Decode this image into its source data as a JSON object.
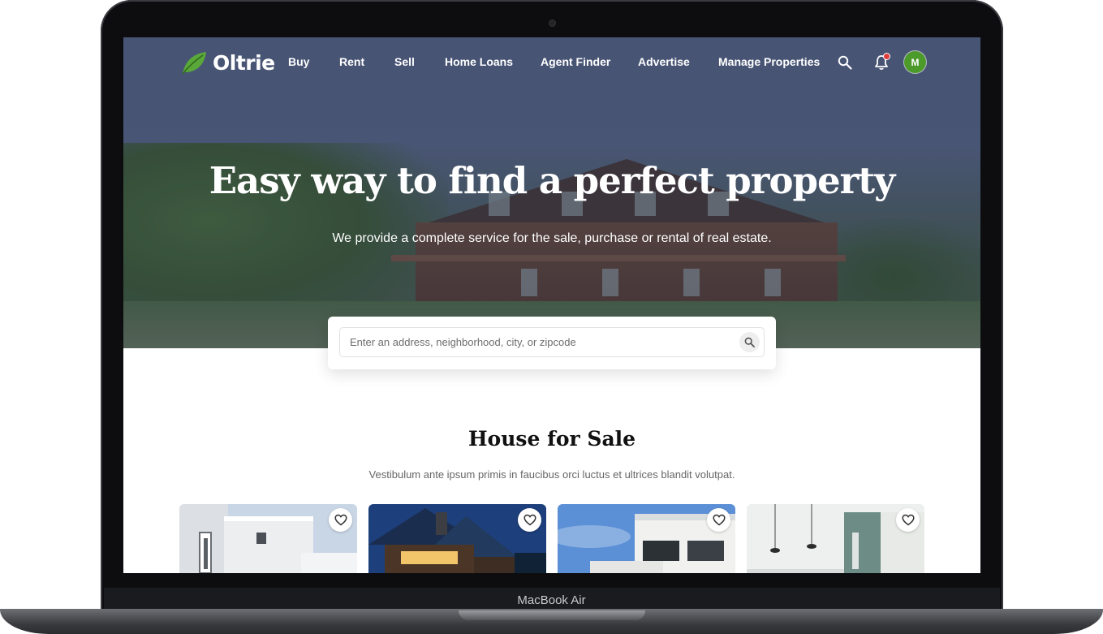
{
  "device": {
    "model_name": "MacBook Air"
  },
  "brand": {
    "name": "Oltrie",
    "accent_color": "#5aa83a"
  },
  "nav": {
    "items": [
      {
        "label": "Buy"
      },
      {
        "label": "Rent"
      },
      {
        "label": "Sell"
      },
      {
        "label": "Home Loans"
      },
      {
        "label": "Agent Finder"
      },
      {
        "label": "Advertise"
      },
      {
        "label": "Manage Properties"
      }
    ],
    "icons": [
      "search-icon",
      "bell-icon"
    ],
    "notification_dot_color": "#e23b3b",
    "avatar": {
      "initial": "M",
      "color": "#4c9a2a"
    }
  },
  "hero": {
    "title": "Easy way to find a perfect property",
    "subtitle": "We provide a complete service for the sale, purchase or rental of real estate."
  },
  "search": {
    "placeholder": "Enter an address, neighborhood, city, or zipcode",
    "icon": "search-icon"
  },
  "listings": {
    "title": "House for Sale",
    "subtitle": "Vestibulum ante ipsum primis in faucibus orci luctus et ultrices blandit volutpat.",
    "cards": [
      {
        "image": "white-modern-house",
        "favorite_icon": "heart-icon"
      },
      {
        "image": "wooden-house-dusk",
        "favorite_icon": "heart-icon"
      },
      {
        "image": "white-balcony-building",
        "favorite_icon": "heart-icon"
      },
      {
        "image": "interior-kitchen",
        "favorite_icon": "heart-icon"
      }
    ]
  }
}
